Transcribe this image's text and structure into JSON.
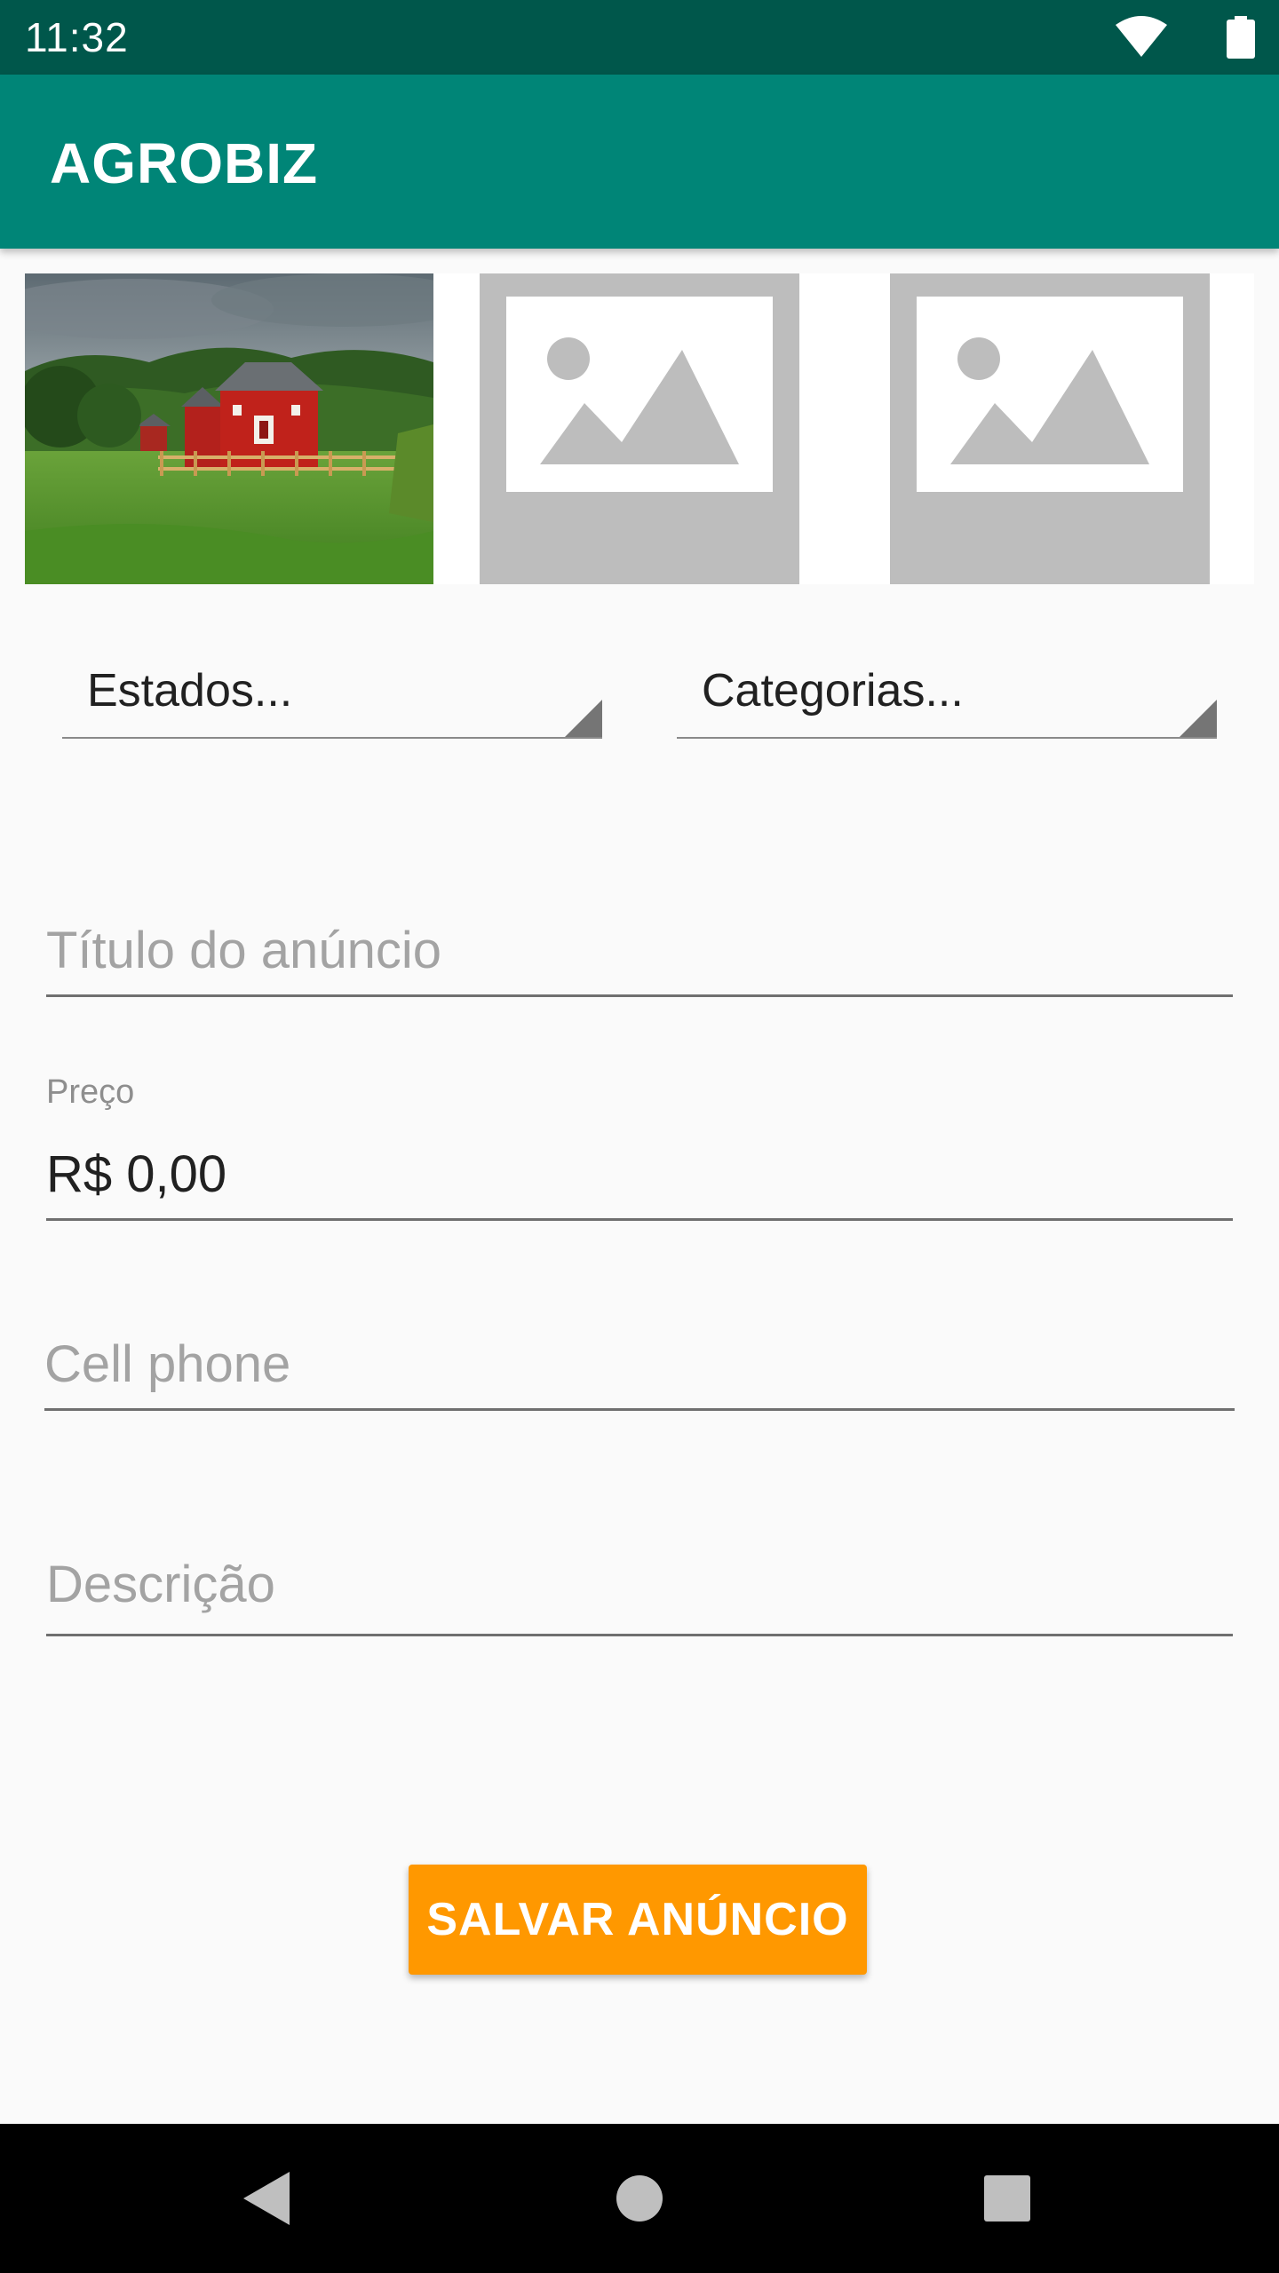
{
  "status_bar": {
    "time": "11:32",
    "wifi_icon": "wifi-icon",
    "battery_icon": "battery-icon"
  },
  "app_bar": {
    "title": "AGROBIZ",
    "color": "#008577"
  },
  "images": [
    {
      "kind": "photo",
      "description_icon": "barn-photo"
    },
    {
      "kind": "placeholder",
      "description_icon": "image-placeholder-icon"
    },
    {
      "kind": "placeholder",
      "description_icon": "image-placeholder-icon"
    }
  ],
  "spinners": {
    "estados": "Estados...",
    "categorias": "Categorias..."
  },
  "form": {
    "titulo_placeholder": "Título do anúncio",
    "preco_label": "Preço",
    "preco_value": "R$ 0,00",
    "cell_placeholder": "Cell phone",
    "descricao_placeholder": "Descrição"
  },
  "actions": {
    "save_label": "SALVAR ANÚNCIO",
    "save_color": "#ff9800"
  },
  "nav_bar": {
    "back_icon": "back-icon",
    "home_icon": "home-icon",
    "recents_icon": "recents-icon"
  }
}
